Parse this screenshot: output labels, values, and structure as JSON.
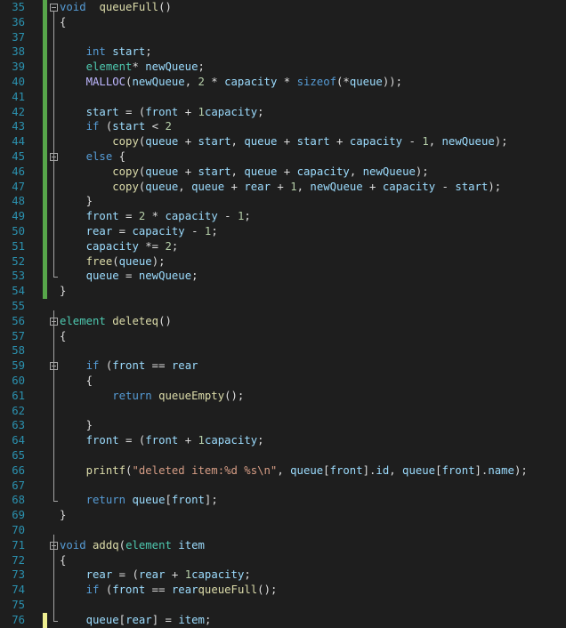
{
  "editor": {
    "first_line": 35,
    "lines": [
      {
        "n": "35",
        "gutter": "saved",
        "fold": true,
        "tokens": [
          [
            "kw",
            "void"
          ],
          [
            "",
            "  "
          ],
          [
            "fn",
            "queueFull"
          ],
          [
            "",
            "()"
          ]
        ],
        "raw_indent": 0
      },
      {
        "n": "36",
        "gutter": "saved",
        "fold": false,
        "tokens": [
          [
            "",
            "{"
          ]
        ],
        "raw_indent": 0
      },
      {
        "n": "37",
        "gutter": "saved",
        "fold": false,
        "tokens": [],
        "raw_indent": 0
      },
      {
        "n": "38",
        "gutter": "saved",
        "fold": false,
        "tokens": [
          [
            "",
            "    "
          ],
          [
            "kw",
            "int"
          ],
          [
            "",
            " "
          ],
          [
            "var",
            "start"
          ],
          [
            "",
            ";"
          ]
        ],
        "raw_indent": 0
      },
      {
        "n": "39",
        "gutter": "saved",
        "fold": false,
        "tokens": [
          [
            "",
            "    "
          ],
          [
            "ty",
            "element"
          ],
          [
            "",
            "* "
          ],
          [
            "var",
            "newQueue"
          ],
          [
            "",
            ";"
          ]
        ],
        "raw_indent": 0
      },
      {
        "n": "40",
        "gutter": "saved",
        "fold": false,
        "tokens": [
          [
            "",
            "    "
          ],
          [
            "mac",
            "MALLOC"
          ],
          [
            "",
            "("
          ],
          [
            "var",
            "newQueue"
          ],
          [
            "",
            ", "
          ],
          [
            "num",
            "2"
          ],
          [
            "",
            " * "
          ],
          [
            "var",
            "capacity"
          ],
          [
            "",
            " * "
          ],
          [
            "kw",
            "sizeof"
          ],
          [
            "",
            "(*"
          ],
          [
            "var",
            "queue"
          ],
          [
            "",
            "));"
          ]
        ],
        "raw_indent": 0
      },
      {
        "n": "41",
        "gutter": "saved",
        "fold": false,
        "tokens": [],
        "raw_indent": 0
      },
      {
        "n": "41",
        "gutter": "saved",
        "fold": false,
        "tokens": [
          [
            "",
            "    "
          ],
          [
            "var",
            "start"
          ],
          [
            "",
            " = ("
          ],
          [
            "var",
            "front"
          ],
          [
            "",
            " + "
          ],
          [
            "num",
            "1"
          ],
          [
            ") % "
          ],
          [
            "var",
            "capacity"
          ],
          [
            "",
            ";"
          ]
        ],
        "raw_indent": 0
      },
      {
        "n": "42",
        "gutter": "saved",
        "fold": false,
        "tokens": [
          [
            "",
            "    "
          ],
          [
            "kw",
            "if"
          ],
          [
            "",
            " ("
          ],
          [
            "var",
            "start"
          ],
          [
            "",
            " < "
          ],
          [
            "num",
            "2"
          ],
          [
            ")"
          ]
        ],
        "raw_indent": 0
      },
      {
        "n": "43",
        "gutter": "saved",
        "fold": false,
        "tokens": [
          [
            "",
            "        "
          ],
          [
            "fn",
            "copy"
          ],
          [
            "",
            "("
          ],
          [
            "var",
            "queue"
          ],
          [
            "",
            " + "
          ],
          [
            "var",
            "start"
          ],
          [
            "",
            ", "
          ],
          [
            "var",
            "queue"
          ],
          [
            "",
            " + "
          ],
          [
            "var",
            "start"
          ],
          [
            "",
            " + "
          ],
          [
            "var",
            "capacity"
          ],
          [
            "",
            " - "
          ],
          [
            "num",
            "1"
          ],
          [
            "",
            ", "
          ],
          [
            "var",
            "newQueue"
          ],
          [
            "",
            ");"
          ]
        ],
        "raw_indent": 0
      },
      {
        "n": "44",
        "gutter": "saved",
        "fold": true,
        "tokens": [
          [
            "",
            "    "
          ],
          [
            "kw",
            "else"
          ],
          [
            "",
            " {"
          ]
        ],
        "raw_indent": 0
      },
      {
        "n": "45",
        "gutter": "saved",
        "fold": false,
        "tokens": [
          [
            "",
            "        "
          ],
          [
            "fn",
            "copy"
          ],
          [
            "",
            "("
          ],
          [
            "var",
            "queue"
          ],
          [
            "",
            " + "
          ],
          [
            "var",
            "start"
          ],
          [
            "",
            ", "
          ],
          [
            "var",
            "queue"
          ],
          [
            "",
            " + "
          ],
          [
            "var",
            "capacity"
          ],
          [
            "",
            ", "
          ],
          [
            "var",
            "newQueue"
          ],
          [
            "",
            ");"
          ]
        ],
        "raw_indent": 0
      },
      {
        "n": "46",
        "gutter": "saved",
        "fold": false,
        "tokens": [
          [
            "",
            "        "
          ],
          [
            "fn",
            "copy"
          ],
          [
            "",
            "("
          ],
          [
            "var",
            "queue"
          ],
          [
            "",
            ", "
          ],
          [
            "var",
            "queue"
          ],
          [
            "",
            " + "
          ],
          [
            "var",
            "rear"
          ],
          [
            "",
            " + "
          ],
          [
            "num",
            "1"
          ],
          [
            "",
            ", "
          ],
          [
            "var",
            "newQueue"
          ],
          [
            "",
            " + "
          ],
          [
            "var",
            "capacity"
          ],
          [
            "",
            " - "
          ],
          [
            "var",
            "start"
          ],
          [
            "",
            ");"
          ]
        ],
        "raw_indent": 0
      },
      {
        "n": "47",
        "gutter": "saved",
        "fold": false,
        "tokens": [
          [
            "",
            "    }"
          ]
        ],
        "raw_indent": 0
      },
      {
        "n": "48",
        "gutter": "saved",
        "fold": false,
        "tokens": [
          [
            "",
            "    "
          ],
          [
            "var",
            "front"
          ],
          [
            "",
            " = "
          ],
          [
            "num",
            "2"
          ],
          [
            "",
            " * "
          ],
          [
            "var",
            "capacity"
          ],
          [
            "",
            " - "
          ],
          [
            "num",
            "1"
          ],
          [
            "",
            ";"
          ]
        ],
        "raw_indent": 0
      },
      {
        "n": "49",
        "gutter": "saved",
        "fold": false,
        "tokens": [
          [
            "",
            "    "
          ],
          [
            "var",
            "rear"
          ],
          [
            "",
            " = "
          ],
          [
            "var",
            "capacity"
          ],
          [
            "",
            " - "
          ],
          [
            "num",
            "1"
          ],
          [
            "",
            ";"
          ]
        ],
        "raw_indent": 0
      },
      {
        "n": "50",
        "gutter": "saved",
        "fold": false,
        "tokens": [
          [
            "",
            "    "
          ],
          [
            "var",
            "capacity"
          ],
          [
            "",
            " *= "
          ],
          [
            "num",
            "2"
          ],
          [
            "",
            ";"
          ]
        ],
        "raw_indent": 0
      },
      {
        "n": "51",
        "gutter": "saved",
        "fold": false,
        "tokens": [
          [
            "",
            "    "
          ],
          [
            "fn",
            "free"
          ],
          [
            "",
            "("
          ],
          [
            "var",
            "queue"
          ],
          [
            "",
            ");"
          ]
        ],
        "raw_indent": 0
      },
      {
        "n": "52",
        "gutter": "saved",
        "fold": false,
        "tokens": [
          [
            "",
            "    "
          ],
          [
            "var",
            "queue"
          ],
          [
            "",
            " = "
          ],
          [
            "var",
            "newQueue"
          ],
          [
            "",
            ";"
          ]
        ],
        "raw_indent": 0
      },
      {
        "n": "53",
        "gutter": "saved",
        "fold": false,
        "tokens": [
          [
            "",
            "}"
          ]
        ],
        "raw_indent": 0
      },
      {
        "n": "54",
        "gutter": "",
        "fold": false,
        "tokens": [],
        "raw_indent": 0
      },
      {
        "n": "55",
        "gutter": "",
        "fold": true,
        "tokens": [
          [
            "ty",
            "element"
          ],
          [
            "",
            " "
          ],
          [
            "fn",
            "deleteq"
          ],
          [
            "",
            "()"
          ]
        ],
        "raw_indent": 0
      },
      {
        "n": "56",
        "gutter": "",
        "fold": false,
        "tokens": [
          [
            "",
            "{"
          ]
        ],
        "raw_indent": 0
      },
      {
        "n": "57",
        "gutter": "",
        "fold": false,
        "tokens": [],
        "raw_indent": 0
      },
      {
        "n": "58",
        "gutter": "",
        "fold": true,
        "tokens": [
          [
            "",
            "    "
          ],
          [
            "kw",
            "if"
          ],
          [
            "",
            " ("
          ],
          [
            "var",
            "front"
          ],
          [
            "",
            " == "
          ],
          [
            "var",
            "rear"
          ],
          [
            ")"
          ]
        ],
        "raw_indent": 0
      },
      {
        "n": "59",
        "gutter": "",
        "fold": false,
        "tokens": [
          [
            "",
            "    {"
          ]
        ],
        "raw_indent": 0
      },
      {
        "n": "60",
        "gutter": "",
        "fold": false,
        "tokens": [
          [
            "",
            "        "
          ],
          [
            "kw",
            "return"
          ],
          [
            "",
            " "
          ],
          [
            "fn",
            "queueEmpty"
          ],
          [
            "",
            "();"
          ]
        ],
        "raw_indent": 0
      },
      {
        "n": "61",
        "gutter": "",
        "fold": false,
        "tokens": [],
        "raw_indent": 0
      },
      {
        "n": "62",
        "gutter": "",
        "fold": false,
        "tokens": [
          [
            "",
            "    }"
          ]
        ],
        "raw_indent": 0
      },
      {
        "n": "63",
        "gutter": "",
        "fold": false,
        "tokens": [
          [
            "",
            "    "
          ],
          [
            "var",
            "front"
          ],
          [
            "",
            " = ("
          ],
          [
            "var",
            "front"
          ],
          [
            "",
            " + "
          ],
          [
            "num",
            "1"
          ],
          [
            ") % "
          ],
          [
            "var",
            "capacity"
          ],
          [
            "",
            ";"
          ]
        ],
        "raw_indent": 0
      },
      {
        "n": "64",
        "gutter": "",
        "fold": false,
        "tokens": [],
        "raw_indent": 0
      },
      {
        "n": "65",
        "gutter": "",
        "fold": false,
        "tokens": [
          [
            "",
            "    "
          ],
          [
            "fn",
            "printf"
          ],
          [
            "",
            "("
          ],
          [
            "str",
            "\"deleted item:%d %s\\n\""
          ],
          [
            "",
            ", "
          ],
          [
            "var",
            "queue"
          ],
          [
            "",
            "["
          ],
          [
            "var",
            "front"
          ],
          [
            "",
            "]."
          ],
          [
            "var",
            "id"
          ],
          [
            "",
            ", "
          ],
          [
            "var",
            "queue"
          ],
          [
            "",
            "["
          ],
          [
            "var",
            "front"
          ],
          [
            "",
            "]."
          ],
          [
            "var",
            "name"
          ],
          [
            "",
            ");"
          ]
        ],
        "raw_indent": 0
      },
      {
        "n": "66",
        "gutter": "",
        "fold": false,
        "tokens": [],
        "raw_indent": 0
      },
      {
        "n": "67",
        "gutter": "",
        "fold": false,
        "tokens": [
          [
            "",
            "    "
          ],
          [
            "kw",
            "return"
          ],
          [
            "",
            " "
          ],
          [
            "var",
            "queue"
          ],
          [
            "",
            "["
          ],
          [
            "var",
            "front"
          ],
          [
            "",
            "];"
          ]
        ],
        "raw_indent": 0
      },
      {
        "n": "68",
        "gutter": "",
        "fold": false,
        "tokens": [
          [
            "",
            "}"
          ]
        ],
        "raw_indent": 0
      },
      {
        "n": "69",
        "gutter": "",
        "fold": false,
        "tokens": [],
        "raw_indent": 0
      },
      {
        "n": "70",
        "gutter": "",
        "fold": true,
        "tokens": [
          [
            "kw",
            "void"
          ],
          [
            "",
            " "
          ],
          [
            "fn",
            "addq"
          ],
          [
            "",
            "("
          ],
          [
            "ty",
            "element"
          ],
          [
            "",
            " "
          ],
          [
            "var",
            "item"
          ],
          [
            ")"
          ]
        ],
        "raw_indent": 0
      },
      {
        "n": "71",
        "gutter": "",
        "fold": false,
        "tokens": [
          [
            "",
            "{"
          ]
        ],
        "raw_indent": 0
      },
      {
        "n": "72",
        "gutter": "",
        "fold": false,
        "tokens": [
          [
            "",
            "    "
          ],
          [
            "var",
            "rear"
          ],
          [
            "",
            " = ("
          ],
          [
            "var",
            "rear"
          ],
          [
            "",
            " + "
          ],
          [
            "num",
            "1"
          ],
          [
            ") % "
          ],
          [
            "var",
            "capacity"
          ],
          [
            "",
            ";"
          ]
        ],
        "raw_indent": 0
      },
      {
        "n": "73",
        "gutter": "",
        "fold": false,
        "tokens": [
          [
            "",
            "    "
          ],
          [
            "kw",
            "if"
          ],
          [
            "",
            " ("
          ],
          [
            "var",
            "front"
          ],
          [
            "",
            " == "
          ],
          [
            "var",
            "rear"
          ],
          [
            ") "
          ],
          [
            "fn",
            "queueFull"
          ],
          [
            "",
            "();"
          ]
        ],
        "raw_indent": 0
      },
      {
        "n": "74",
        "gutter": "",
        "fold": false,
        "tokens": [],
        "raw_indent": 0
      },
      {
        "n": "75",
        "gutter": "unsaved",
        "fold": false,
        "tokens": [
          [
            "",
            "    "
          ],
          [
            "var",
            "queue"
          ],
          [
            "",
            "["
          ],
          [
            "var",
            "rear"
          ],
          [
            "",
            "] = "
          ],
          [
            "var",
            "item"
          ],
          [
            "",
            ";"
          ]
        ],
        "raw_indent": 0
      },
      {
        "n": "76",
        "gutter": "",
        "fold": false,
        "tokens": [
          [
            "",
            "}"
          ]
        ],
        "raw_indent": 0
      }
    ]
  },
  "colors": {
    "background": "#1e1e1e",
    "line_number": "#2b91af",
    "keyword": "#569cd6",
    "type": "#4ec9b0",
    "function": "#dcdcaa",
    "variable": "#9cdcfe",
    "number": "#b5cea8",
    "string": "#d69d85",
    "gutter_saved": "#57a64a",
    "gutter_unsaved": "#efef91"
  }
}
